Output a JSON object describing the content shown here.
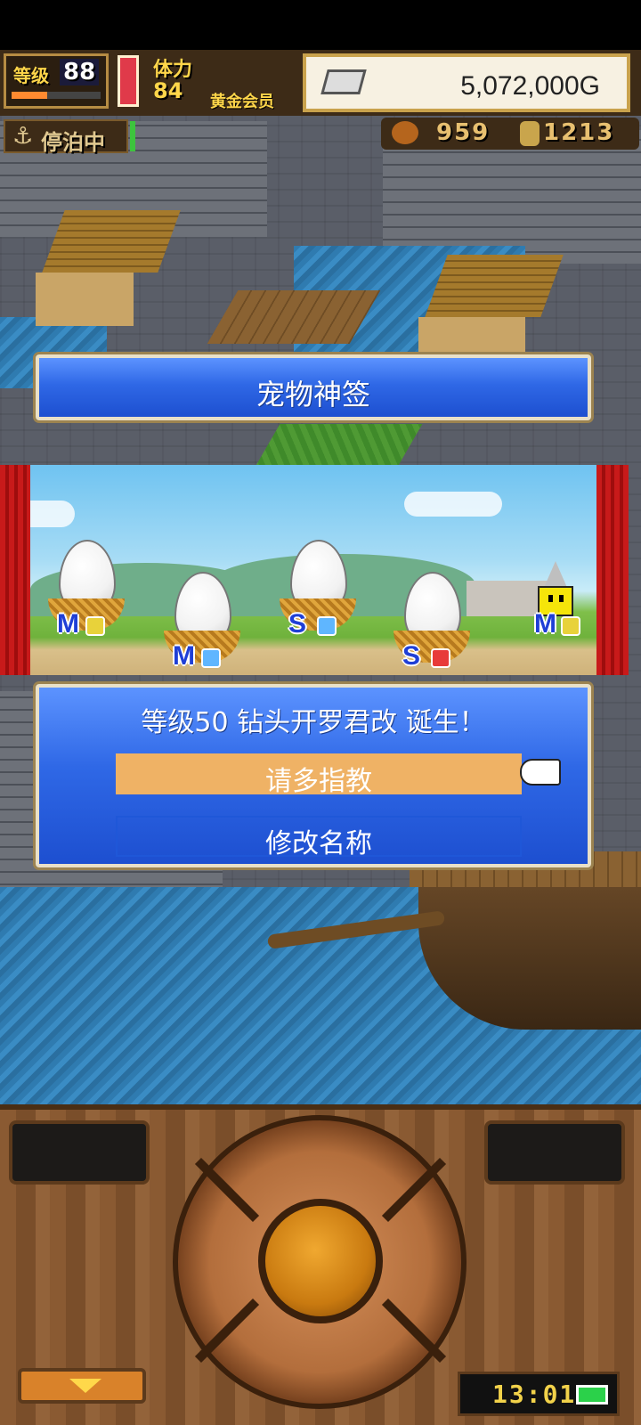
{
  "hud": {
    "level_label": "等级",
    "level_value": "88",
    "level_progress": 0.4,
    "stamina_label": "体力",
    "stamina_value": "84",
    "membership": "黄金会员",
    "money": "5,072,000G",
    "status": "停泊中",
    "food_count": "959",
    "wood_count": "1213"
  },
  "dialog": {
    "title": "宠物神签",
    "message": "等级50 钻头开罗君改 诞生！",
    "confirm_label": "请多指教",
    "rename_label": "修改名称"
  },
  "eggs": [
    {
      "grade": "M",
      "gem_color": "#e8d23a"
    },
    {
      "grade": "M",
      "gem_color": "#5fb6ff"
    },
    {
      "grade": "S",
      "gem_color": "#5fb6ff"
    },
    {
      "grade": "S",
      "gem_color": "#e83a3a"
    }
  ],
  "hatched": {
    "grade": "M",
    "gem_color": "#e8d23a"
  },
  "console": {
    "clock": "13:01"
  },
  "colors": {
    "panel_blue": "#2f68e6",
    "highlight_orange": "#efb265",
    "gold_text": "#ffd64a"
  }
}
